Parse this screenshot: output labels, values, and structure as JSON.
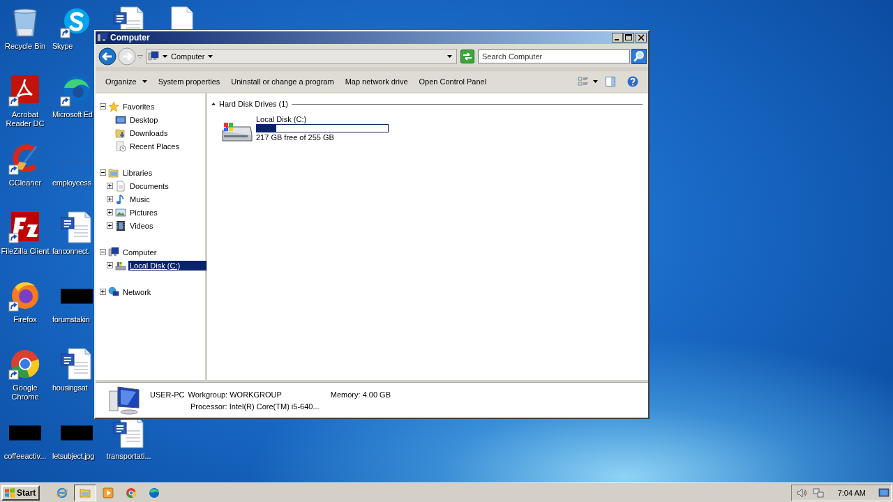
{
  "desktop_icons": [
    {
      "kind": "recycle_bin",
      "label": "Recycle Bin",
      "shortcut": false
    },
    {
      "kind": "acrobat",
      "label": "Acrobat Reader DC",
      "shortcut": true
    },
    {
      "kind": "ccleaner",
      "label": "CCleaner",
      "shortcut": true
    },
    {
      "kind": "filezilla",
      "label": "FileZilla Client",
      "shortcut": true
    },
    {
      "kind": "firefox",
      "label": "Firefox",
      "shortcut": true
    },
    {
      "kind": "chrome",
      "label": "Google Chrome",
      "shortcut": true
    },
    {
      "kind": "black_thumb",
      "label": "coffeeactiv...",
      "shortcut": false
    },
    {
      "kind": "skype",
      "label": "Skype",
      "shortcut": true
    },
    {
      "kind": "edge",
      "label": "Microsoft Ed",
      "shortcut": true
    },
    {
      "kind": "thin_thumb",
      "label": "employeess",
      "shortcut": false
    },
    {
      "kind": "word_doc",
      "label": "fanconnect.",
      "shortcut": false
    },
    {
      "kind": "black_thumb",
      "label": "forumstakin",
      "shortcut": false
    },
    {
      "kind": "word_doc",
      "label": "housingsat",
      "shortcut": false
    },
    {
      "kind": "black_thumb",
      "label": "letsubject.jpg",
      "shortcut": false
    },
    {
      "kind": "word_doc",
      "shortcut": false
    },
    {
      "kind": "blank_doc",
      "shortcut": false
    },
    {
      "kind": "word_doc",
      "label": "transportati...",
      "shortcut": false
    }
  ],
  "window": {
    "title": "Computer",
    "address": {
      "crumbs": [
        "Computer"
      ]
    },
    "search": {
      "placeholder": "Search Computer"
    },
    "toolbar": [
      {
        "label": "Organize",
        "menu": true
      },
      {
        "label": "System properties",
        "menu": false
      },
      {
        "label": "Uninstall or change a program",
        "menu": false
      },
      {
        "label": "Map network drive",
        "menu": false
      },
      {
        "label": "Open Control Panel",
        "menu": false
      }
    ],
    "nav_tree": [
      {
        "label": "Favorites",
        "kind": "star",
        "expanded": true,
        "selected": false,
        "children": [
          {
            "label": "Desktop",
            "kind": "desktop",
            "selected": false
          },
          {
            "label": "Downloads",
            "kind": "downloads",
            "selected": false
          },
          {
            "label": "Recent Places",
            "kind": "recent",
            "selected": false
          }
        ]
      },
      {
        "label": "Libraries",
        "kind": "library",
        "expanded": true,
        "selected": false,
        "children": [
          {
            "label": "Documents",
            "kind": "documents",
            "expanded": false,
            "selected": false
          },
          {
            "label": "Music",
            "kind": "music",
            "expanded": false,
            "selected": false
          },
          {
            "label": "Pictures",
            "kind": "pictures",
            "expanded": false,
            "selected": false
          },
          {
            "label": "Videos",
            "kind": "videos",
            "expanded": false,
            "selected": false
          }
        ]
      },
      {
        "label": "Computer",
        "kind": "computer",
        "expanded": true,
        "selected": false,
        "children": [
          {
            "label": "Local Disk (C:)",
            "kind": "drive",
            "expanded": false,
            "selected": true
          }
        ]
      },
      {
        "label": "Network",
        "kind": "network",
        "expanded": false,
        "selected": false
      }
    ],
    "groups": [
      {
        "title": "Hard Disk Drives (1)",
        "expanded": true,
        "drives": [
          {
            "name": "Local Disk (C:)",
            "level": 0.15,
            "space": "217 GB free of 255 GB"
          }
        ]
      }
    ],
    "details": {
      "name": "USER-PC",
      "workgroup": "Workgroup: WORKGROUP",
      "memory": "Memory: 4.00 GB",
      "processor": "Processor: Intel(R) Core(TM) i5-640..."
    }
  },
  "taskbar": {
    "start": "Start",
    "apps": [
      {
        "kind": "ie",
        "selected": false
      },
      {
        "kind": "explorer",
        "selected": true
      },
      {
        "kind": "media",
        "selected": false
      },
      {
        "kind": "chrome",
        "selected": false
      },
      {
        "kind": "edge",
        "selected": false
      }
    ],
    "clock": "7:04 AM"
  }
}
